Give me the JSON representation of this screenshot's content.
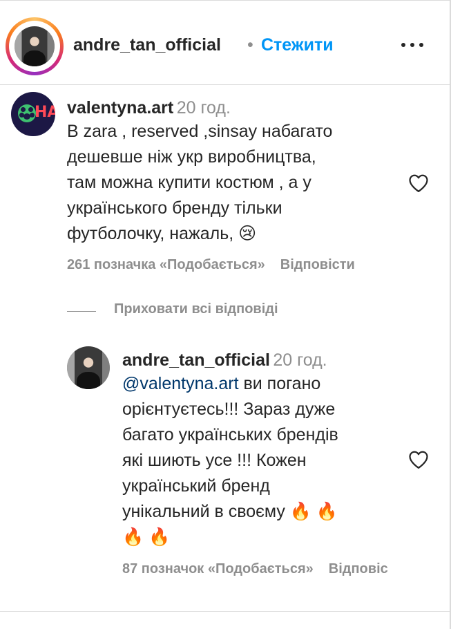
{
  "header": {
    "username": "andre_tan_official",
    "separator": "•",
    "follow_label": "Стежити"
  },
  "comment": {
    "avatar_text": "HA",
    "username": "valentyna.art",
    "time": "20 год.",
    "text": "В zara , reserved ,sinsay набагато\nдешевше ніж укр виробництва,\nтам можна купити костюм , а у\nукраїнського бренду тільки\nфутболочку, нажаль, 😢",
    "likes": "261 позначка «Подобається»",
    "reply_label": "Відповісти"
  },
  "hide_replies_label": "Приховати всі відповіді",
  "reply": {
    "username": "andre_tan_official",
    "time": "20 год.",
    "mention": "@valentyna.art",
    "text_first": " ви погано",
    "text_rest": "орієнтуєтесь!!! Зараз дуже\nбагато українських брендів\nякі шиють усе !!! Кожен\nукраїнський бренд\nунікальний в своєму 🔥 🔥\n🔥 🔥",
    "likes": "87 позначок «Подобається»",
    "reply_label": "Відповіс"
  },
  "icons": {
    "more": "more-options-icon",
    "heart": "heart-outline-icon"
  },
  "colors": {
    "accent": "#0095f6",
    "mention": "#00376b",
    "muted": "#8e8e8e",
    "text": "#262626"
  }
}
